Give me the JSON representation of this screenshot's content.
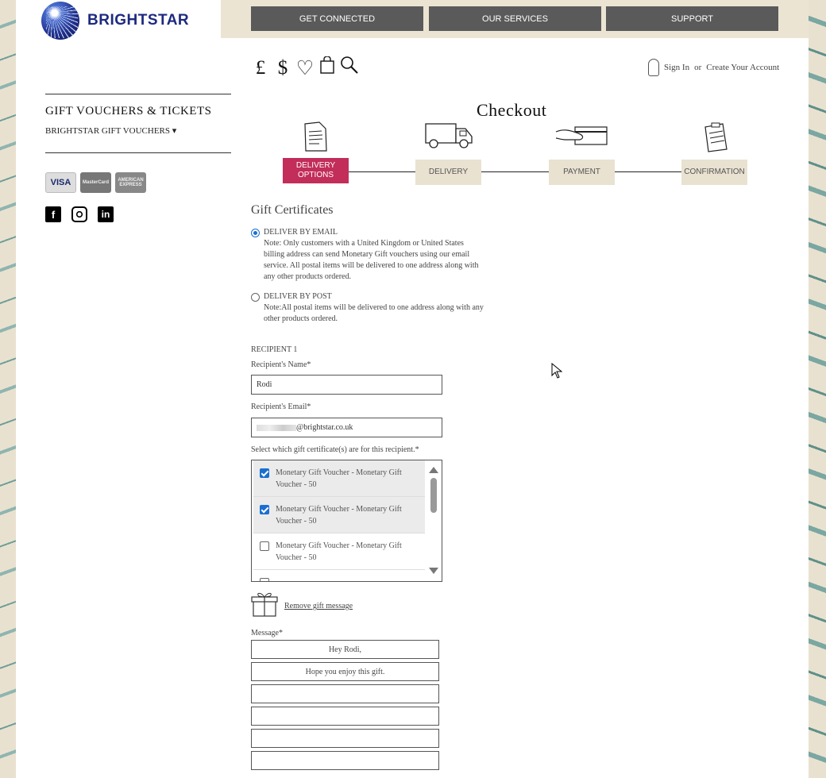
{
  "brand": {
    "name": "BRIGHTSTAR"
  },
  "nav": [
    {
      "label": "GET CONNECTED"
    },
    {
      "label": "OUR SERVICES"
    },
    {
      "label": "SUPPORT"
    }
  ],
  "tools": {
    "pound": "£",
    "dollar": "$",
    "heart": "♡",
    "bag": "🛍",
    "search": "🔍"
  },
  "account": {
    "signin": "Sign In",
    "or": "or",
    "create": "Create Your Account"
  },
  "sidebar": {
    "title": "GIFT VOUCHERS & TICKETS",
    "subtitle": "BRIGHTSTAR GIFT VOUCHERS ▾",
    "cards": [
      "VISA",
      "MasterCard",
      "AMERICAN EXPRESS"
    ],
    "socials": [
      "facebook",
      "instagram",
      "linkedin"
    ]
  },
  "checkout": {
    "title": "Checkout",
    "steps": [
      {
        "label": "DELIVERY OPTIONS",
        "icon": "document-icon"
      },
      {
        "label": "DELIVERY",
        "icon": "van-icon"
      },
      {
        "label": "PAYMENT",
        "icon": "card-hand-icon"
      },
      {
        "label": "CONFIRMATION",
        "icon": "clipboard-icon"
      }
    ]
  },
  "gift": {
    "section_title": "Gift Certificates",
    "options": [
      {
        "label": "DELIVER BY EMAIL",
        "selected": true,
        "note": "Note: Only customers with a United Kingdom or United States billing address can send Monetary Gift vouchers using our email service. All postal items will be delivered to one address along with any other products ordered."
      },
      {
        "label": "DELIVER BY POST",
        "selected": false,
        "note": "Note:All postal items will be delivered to one address along with any other products ordered."
      }
    ],
    "recipient_heading": "RECIPIENT 1",
    "name_label": "Recipient's Name*",
    "name_value": "Rodi",
    "email_label": "Recipient's Email*",
    "email_value": "@brightstar.co.uk",
    "select_label": "Select which gift certificate(s) are for this recipient.*",
    "vouchers": [
      {
        "text": "Monetary Gift Voucher - Monetary Gift Voucher - 50",
        "checked": true
      },
      {
        "text": "Monetary Gift Voucher - Monetary Gift Voucher - 50",
        "checked": true
      },
      {
        "text": "Monetary Gift Voucher - Monetary Gift Voucher - 50",
        "checked": false
      }
    ],
    "remove_message": "Remove gift message",
    "message_label": "Message*",
    "message_lines": [
      "Hey Rodi,",
      "Hope you enjoy this gift.",
      "",
      "",
      "",
      ""
    ]
  }
}
